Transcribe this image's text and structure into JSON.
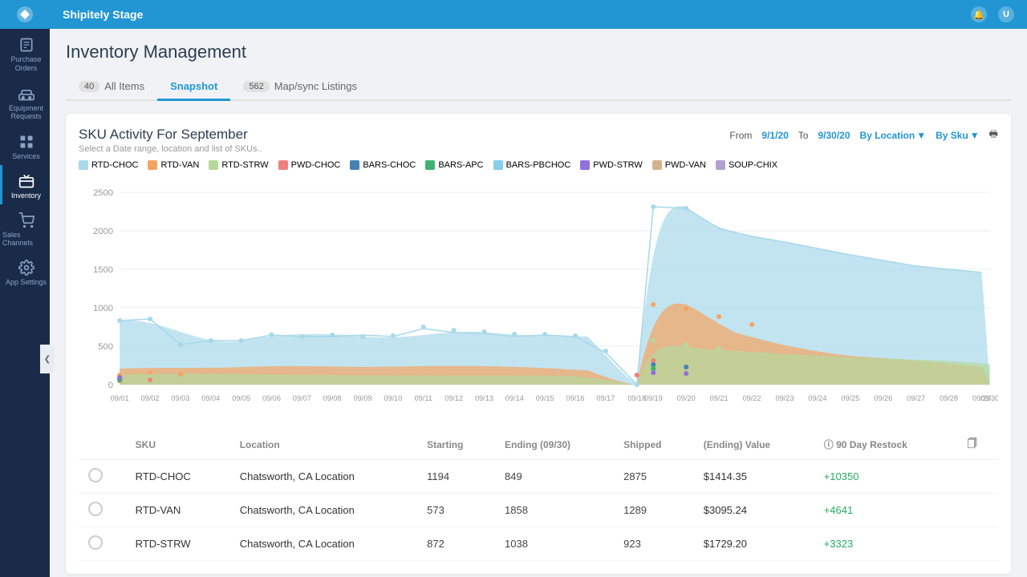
{
  "topbar": {
    "title": "Shipitely Stage"
  },
  "page": {
    "title": "Inventory Management"
  },
  "tabs": [
    {
      "id": "all-items",
      "badge": "40",
      "label": "All Items",
      "active": false
    },
    {
      "id": "snapshot",
      "badge": null,
      "label": "Snapshot",
      "active": true
    },
    {
      "id": "map-sync",
      "badge": "562",
      "label": "Map/sync Listings",
      "active": false
    }
  ],
  "chart": {
    "title": "SKU Activity For September",
    "subtitle": "Select a Date range, location and list of SKUs..",
    "from_label": "From",
    "from_date": "9/1/20",
    "to_label": "To",
    "to_date": "9/30/20",
    "by_location": "By Location",
    "by_sku": "By Sku",
    "legend": [
      {
        "id": "RTD-CHOC",
        "label": "RTD-CHOC",
        "color": "#a8d8ea"
      },
      {
        "id": "RTD-VAN",
        "label": "RTD-VAN",
        "color": "#f4a460"
      },
      {
        "id": "RTD-STRW",
        "label": "RTD-STRW",
        "color": "#b5d99c"
      },
      {
        "id": "PWD-CHOC",
        "label": "PWD-CHOC",
        "color": "#f08080"
      },
      {
        "id": "BARS-CHOC",
        "label": "BARS-CHOC",
        "color": "#4682b4"
      },
      {
        "id": "BARS-APC",
        "label": "BARS-APC",
        "color": "#3cb371"
      },
      {
        "id": "BARS-PBCHOC",
        "label": "BARS-PBCHOC",
        "color": "#87ceeb"
      },
      {
        "id": "PWD-STRW",
        "label": "PWD-STRW",
        "color": "#9370db"
      },
      {
        "id": "PWD-VAN",
        "label": "PWD-VAN",
        "color": "#d2b48c"
      },
      {
        "id": "SOUP-CHIX",
        "label": "SOUP-CHIX",
        "color": "#b0a0d0"
      }
    ],
    "y_labels": [
      "0",
      "500",
      "1000",
      "1500",
      "2000",
      "2500"
    ],
    "x_labels": [
      "09/01",
      "09/02",
      "09/03",
      "09/04",
      "09/05",
      "09/06",
      "09/07",
      "09/08",
      "09/09",
      "09/10",
      "09/11",
      "09/12",
      "09/13",
      "09/14",
      "09/15",
      "09/16",
      "09/17",
      "09/18",
      "09/19",
      "09/20",
      "09/21",
      "09/22",
      "09/23",
      "09/24",
      "09/25",
      "09/26",
      "09/27",
      "09/28",
      "09/29",
      "09/30"
    ]
  },
  "table": {
    "headers": [
      "",
      "SKU",
      "Location",
      "Starting",
      "Ending (09/30)",
      "Shipped",
      "(Ending) Value",
      "90 Day Restock",
      ""
    ],
    "rows": [
      {
        "sku": "RTD-CHOC",
        "location": "Chatsworth, CA Location",
        "starting": "1194",
        "ending": "849",
        "shipped": "2875",
        "value": "$1414.35",
        "restock": "+10350"
      },
      {
        "sku": "RTD-VAN",
        "location": "Chatsworth, CA Location",
        "starting": "573",
        "ending": "1858",
        "shipped": "1289",
        "value": "$3095.24",
        "restock": "+4641"
      },
      {
        "sku": "RTD-STRW",
        "location": "Chatsworth, CA Location",
        "starting": "872",
        "ending": "1038",
        "shipped": "923",
        "value": "$1729.20",
        "restock": "+3323"
      }
    ]
  },
  "sidebar": {
    "items": [
      {
        "id": "purchase-orders",
        "label": "Purchase Orders",
        "icon": "file"
      },
      {
        "id": "equipment",
        "label": "Equipment Requests",
        "icon": "truck"
      },
      {
        "id": "services",
        "label": "Services",
        "icon": "grid"
      },
      {
        "id": "inventory",
        "label": "Inventory",
        "icon": "chart",
        "active": true
      },
      {
        "id": "sales-channels",
        "label": "Sales Channels",
        "icon": "cart"
      },
      {
        "id": "app-settings",
        "label": "App Settings",
        "icon": "gear"
      }
    ]
  }
}
